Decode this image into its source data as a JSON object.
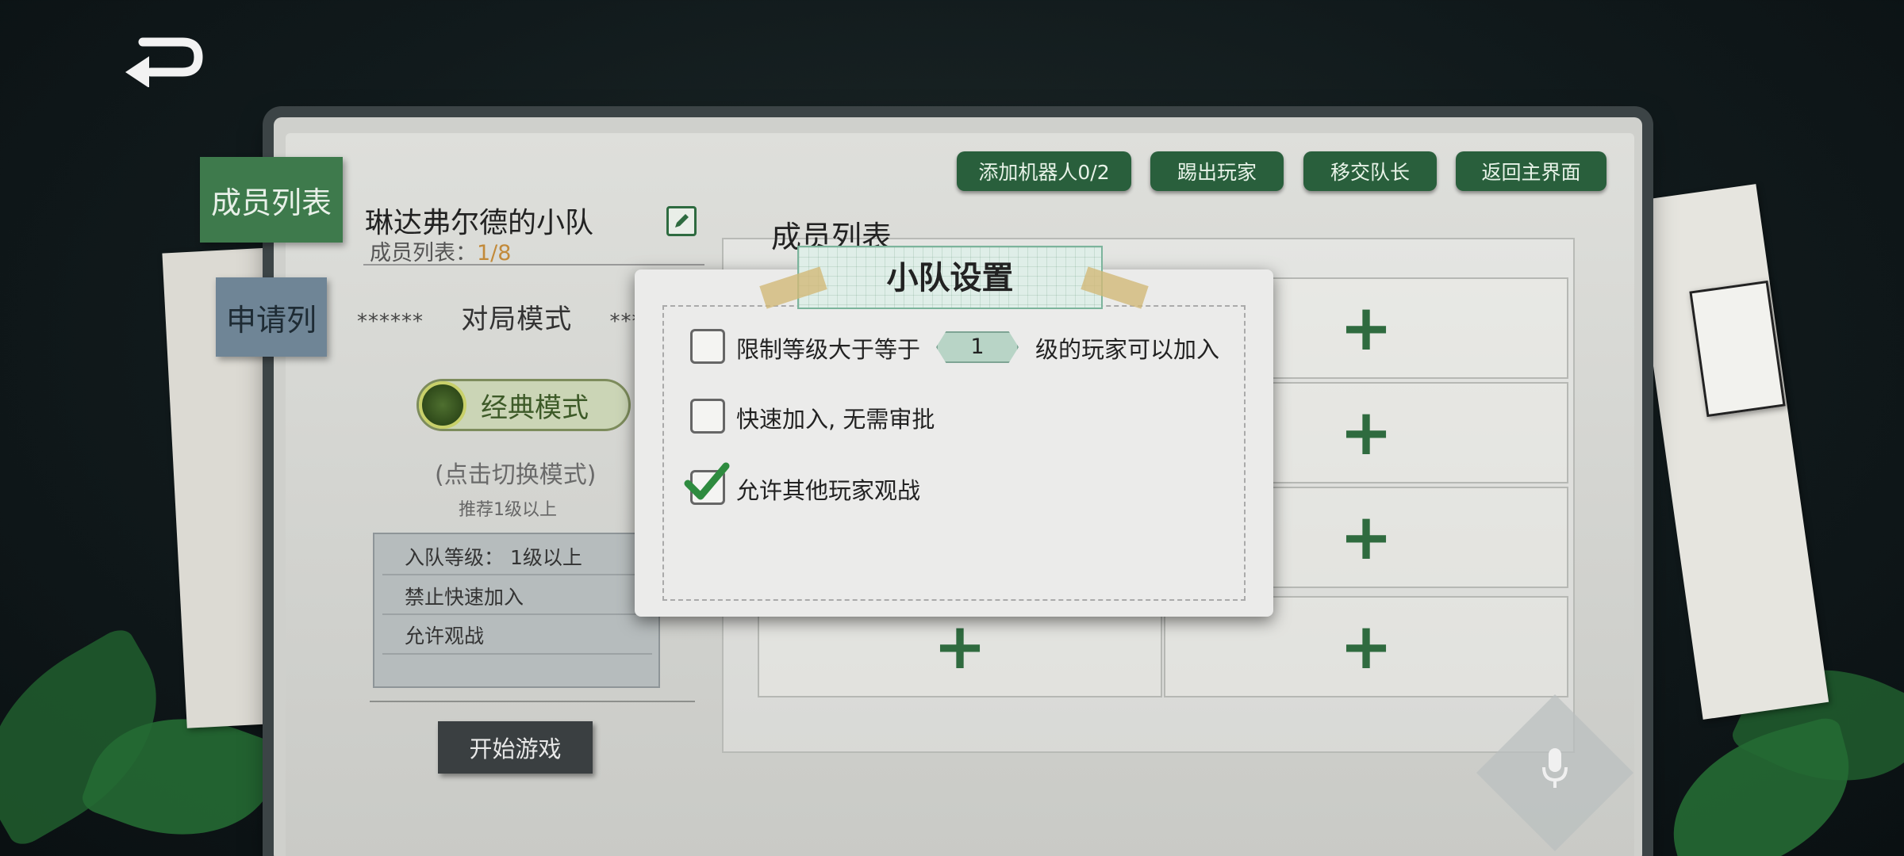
{
  "header": {
    "back_icon": "back-arrow-icon"
  },
  "tabs": {
    "members_label": "成员列表",
    "apply_label": "申请列"
  },
  "team": {
    "name": "琳达弗尔德的小队",
    "member_count_label": "成员列表：",
    "member_count": "1/8"
  },
  "mode": {
    "stars_left": "******",
    "label": "对局模式",
    "stars_right": "*****",
    "current": "经典模式",
    "hint": "(点击切换模式)",
    "recommend": "推荐1级以上"
  },
  "rules": [
    "入队等级：  1级以上",
    "禁止快速加入",
    "允许观战"
  ],
  "start_button": "开始游戏",
  "toolbar": {
    "add_bot": "添加机器人0/2",
    "kick": "踢出玩家",
    "transfer": "移交队长",
    "return_main": "返回主界面"
  },
  "grid": {
    "title": "成员列表",
    "slots": [
      "+",
      "+",
      "+",
      "+",
      "+",
      "+",
      "+",
      "+"
    ]
  },
  "modal": {
    "title": "小队设置",
    "options": [
      {
        "label_before": "限制等级大于等于",
        "value": "1",
        "label_after": "级的玩家可以加入",
        "checked": false
      },
      {
        "label": "快速加入, 无需审批",
        "checked": false
      },
      {
        "label": "允许其他玩家观战",
        "checked": true
      }
    ]
  },
  "colors": {
    "accent_green": "#295f3c",
    "check_green": "#2e8b3f",
    "count_orange": "#c28a3a"
  }
}
